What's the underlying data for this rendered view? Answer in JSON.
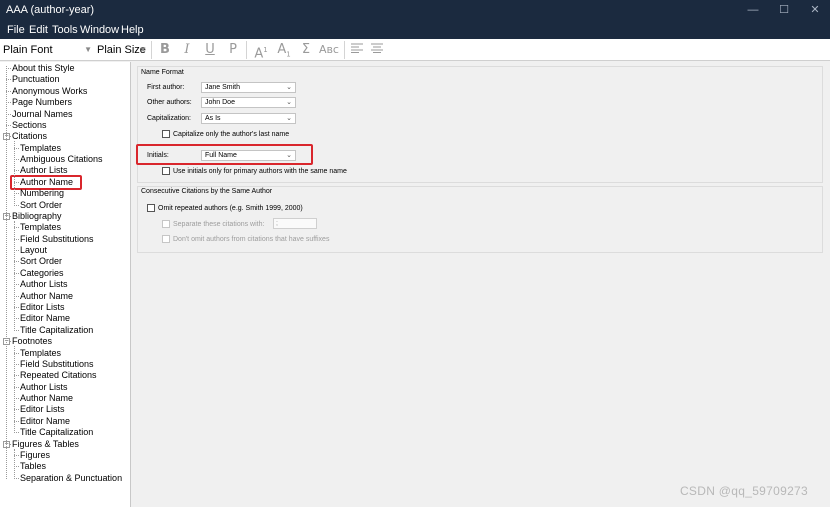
{
  "window": {
    "title": "AAA (author-year)",
    "controls": {
      "minimize": "—",
      "maximize": "☐",
      "close": "✕"
    }
  },
  "menu": [
    "File",
    "Edit",
    "Tools",
    "Window",
    "Help"
  ],
  "toolbar": {
    "font": "Plain Font",
    "size": "Plain Size",
    "bold": "B",
    "italic": "I",
    "underline": "U",
    "plain": "P",
    "superscript": "A",
    "superscript_mark": "1",
    "subscript": "A",
    "subscript_mark": "1",
    "sigma": "Σ",
    "smallcaps": "Aʙᴄ"
  },
  "tree": [
    {
      "label": "About this Style"
    },
    {
      "label": "Punctuation"
    },
    {
      "label": "Anonymous Works"
    },
    {
      "label": "Page Numbers"
    },
    {
      "label": "Journal Names"
    },
    {
      "label": "Sections"
    },
    {
      "label": "Citations",
      "group": true
    },
    {
      "label": "Templates"
    },
    {
      "label": "Ambiguous Citations"
    },
    {
      "label": "Author Lists"
    },
    {
      "label": "Author Name",
      "highlighted": true
    },
    {
      "label": "Numbering"
    },
    {
      "label": "Sort Order"
    },
    {
      "label": "Bibliography",
      "group": true
    },
    {
      "label": "Templates"
    },
    {
      "label": "Field Substitutions"
    },
    {
      "label": "Layout"
    },
    {
      "label": "Sort Order"
    },
    {
      "label": "Categories"
    },
    {
      "label": "Author Lists"
    },
    {
      "label": "Author Name"
    },
    {
      "label": "Editor Lists"
    },
    {
      "label": "Editor Name"
    },
    {
      "label": "Title Capitalization"
    },
    {
      "label": "Footnotes",
      "group": true
    },
    {
      "label": "Templates"
    },
    {
      "label": "Field Substitutions"
    },
    {
      "label": "Repeated Citations"
    },
    {
      "label": "Author Lists"
    },
    {
      "label": "Author Name"
    },
    {
      "label": "Editor Lists"
    },
    {
      "label": "Editor Name"
    },
    {
      "label": "Title Capitalization"
    },
    {
      "label": "Figures & Tables",
      "group": true
    },
    {
      "label": "Figures"
    },
    {
      "label": "Tables"
    },
    {
      "label": "Separation & Punctuation"
    }
  ],
  "name_format": {
    "title": "Name Format",
    "first_author_label": "First author:",
    "first_author_value": "Jane Smith",
    "other_authors_label": "Other authors:",
    "other_authors_value": "John Doe",
    "capitalization_label": "Capitalization:",
    "capitalization_value": "As Is",
    "cap_last_name_label": "Capitalize only the author's last name",
    "cap_last_name_checked": false,
    "initials_label": "Initials:",
    "initials_value": "Full Name",
    "use_initials_label": "Use initials only for primary authors with the same name",
    "use_initials_checked": false
  },
  "consecutive": {
    "title": "Consecutive Citations by the Same Author",
    "omit_label": "Omit repeated authors (e.g. Smith 1999, 2000)",
    "omit_checked": false,
    "separate_label": "Separate these citations with:",
    "separate_value": ";",
    "dont_omit_label": "Don't omit authors from citations that have suffixes"
  },
  "watermark": "CSDN @qq_59709273",
  "colors": {
    "titlebar": "#1b2a3f",
    "highlight": "#d9262c",
    "panel": "#f0f0f0"
  }
}
